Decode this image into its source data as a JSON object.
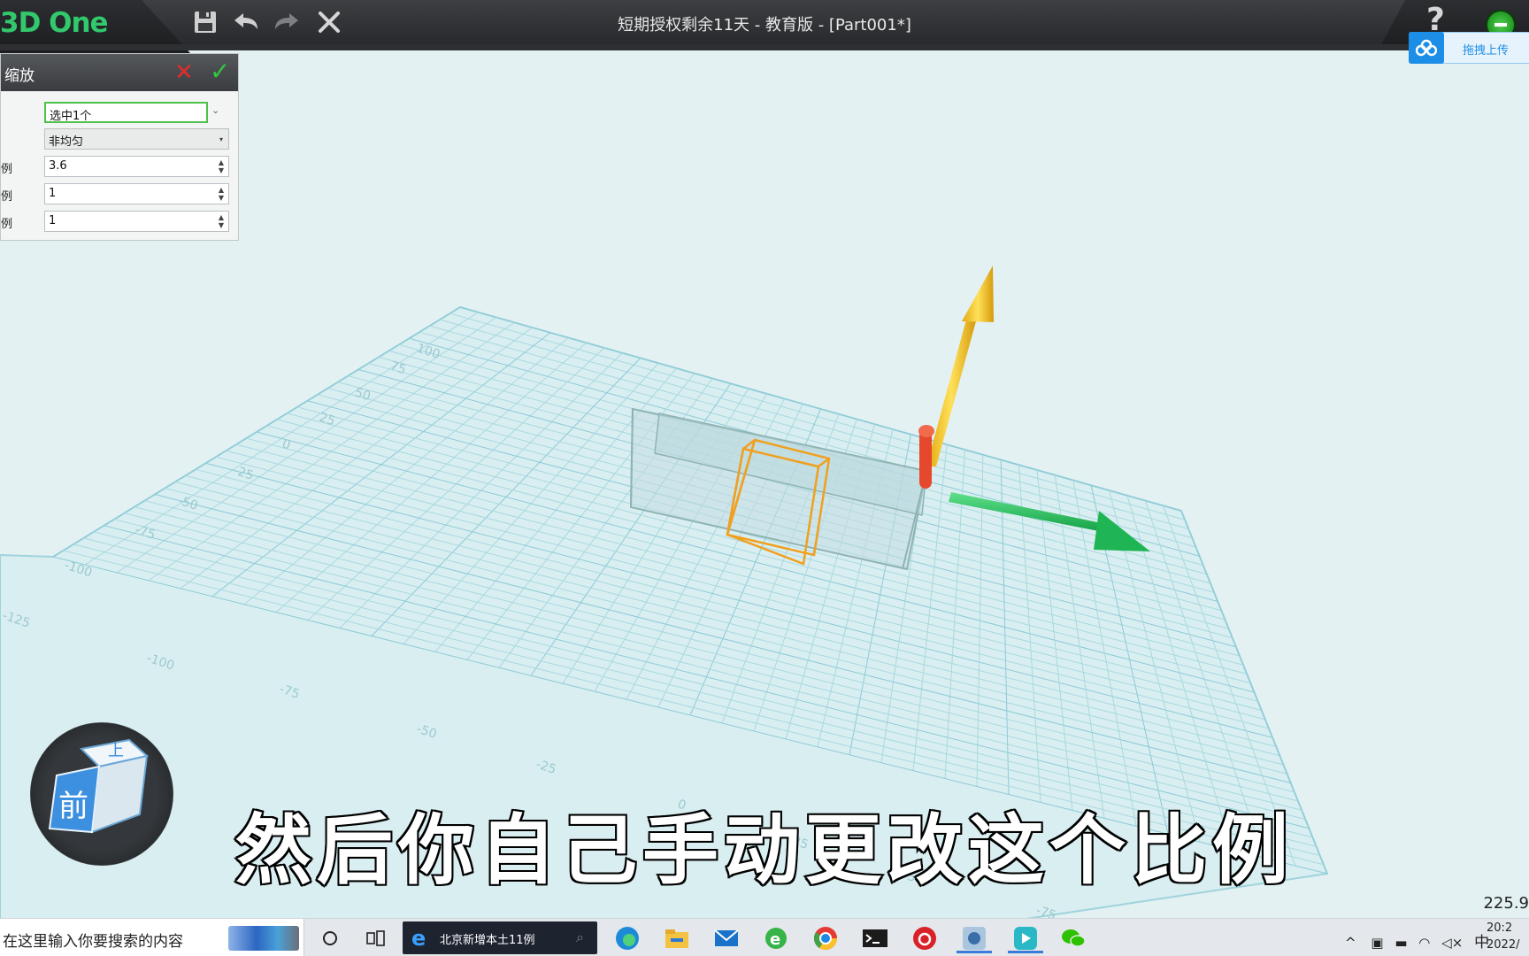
{
  "app": {
    "brand": "3D One",
    "window_title": "短期授权剩余11天 - 教育版 - [Part001*]",
    "help_glyph": "?"
  },
  "toolbar": {
    "icons": [
      "save-icon",
      "undo-icon",
      "redo-icon",
      "close-icon"
    ]
  },
  "upload": {
    "label": "拖拽上传"
  },
  "scale_panel": {
    "title": "缩放",
    "fields": [
      {
        "label": "",
        "value": "选中1个"
      },
      {
        "label": "",
        "value": "非均匀"
      },
      {
        "label": "例",
        "value": "3.6"
      },
      {
        "label": "例",
        "value": "1"
      },
      {
        "label": "例",
        "value": "1"
      }
    ]
  },
  "viewport": {
    "grid_labels": [
      "-125",
      "-100",
      "-75",
      "-50",
      "-25",
      "0",
      "25",
      "50",
      "75",
      "100",
      "-100",
      "-75",
      "-50",
      "-25",
      "0",
      "-25",
      "-50",
      "-75"
    ],
    "gizmo_colors": {
      "y_axis": "#f2c21a",
      "x_axis": "#22c35a",
      "z_axis": "#e5482c"
    },
    "view_cube_face": "前",
    "view_cube_top": "上"
  },
  "subtitle": "然后你自己手动更改这个比例",
  "coord_readout": "225.9",
  "taskbar": {
    "search_placeholder": "在这里输入你要搜索的内容",
    "ie_task_label": "北京新增本土11例",
    "ime": "中",
    "time": "20:2",
    "date": "2022/"
  }
}
